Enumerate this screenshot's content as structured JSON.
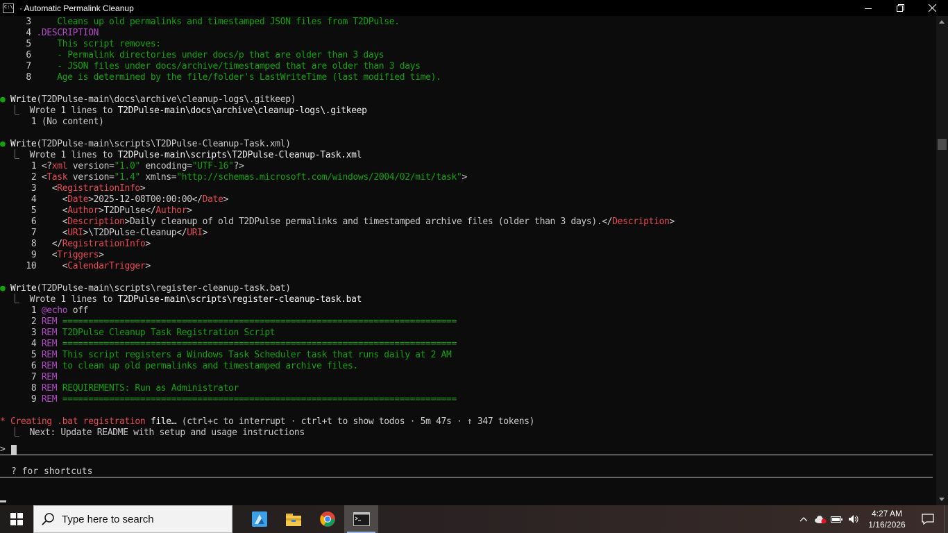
{
  "window": {
    "title": "· Automatic Permalink Cleanup"
  },
  "terminal": {
    "lines": [
      {
        "y": 0,
        "segs": [
          [
            "c-ln",
            "     3 "
          ],
          [
            "c-green",
            "    Cleans up old permalinks and timestamped JSON files from T2DPulse."
          ]
        ]
      },
      {
        "y": 1,
        "segs": [
          [
            "c-ln",
            "     4 "
          ],
          [
            "c-purple",
            ".DESCRIPTION"
          ]
        ]
      },
      {
        "y": 2,
        "segs": [
          [
            "c-ln",
            "     5 "
          ],
          [
            "c-green",
            "    This script removes:"
          ]
        ]
      },
      {
        "y": 3,
        "segs": [
          [
            "c-ln",
            "     6 "
          ],
          [
            "c-green",
            "    - Permalink directories under docs/p that are older than 3 days"
          ]
        ]
      },
      {
        "y": 4,
        "segs": [
          [
            "c-ln",
            "     7 "
          ],
          [
            "c-green",
            "    - JSON files under docs/archive/timestamped that are older than 3 days"
          ]
        ]
      },
      {
        "y": 5,
        "segs": [
          [
            "c-ln",
            "     8 "
          ],
          [
            "c-green",
            "    Age is determined by the file/folder's LastWriteTime (last modified time)."
          ]
        ]
      },
      {
        "y": 7,
        "segs": [
          [
            "bullet-green",
            "● "
          ],
          [
            "c-white",
            "Write"
          ],
          [
            "c-gray",
            "(T2DPulse-main\\docs\\archive\\cleanup-logs\\.gitkeep)"
          ]
        ]
      },
      {
        "y": 8,
        "segs": [
          [
            "glyph-box",
            "  ⎿  "
          ],
          [
            "c-gray",
            "Wrote 1 lines to "
          ],
          [
            "c-white",
            "T2DPulse-main\\docs\\archive\\cleanup-logs\\.gitkeep"
          ]
        ]
      },
      {
        "y": 9,
        "segs": [
          [
            "c-ln",
            "      1 "
          ],
          [
            "c-gray",
            "(No content)"
          ]
        ]
      },
      {
        "y": 11,
        "segs": [
          [
            "bullet-green",
            "● "
          ],
          [
            "c-white",
            "Write"
          ],
          [
            "c-gray",
            "(T2DPulse-main\\scripts\\T2DPulse-Cleanup-Task.xml)"
          ]
        ]
      },
      {
        "y": 12,
        "segs": [
          [
            "glyph-box",
            "  ⎿  "
          ],
          [
            "c-gray",
            "Wrote 1 lines to "
          ],
          [
            "c-white",
            "T2DPulse-main\\scripts\\T2DPulse-Cleanup-Task.xml"
          ]
        ]
      },
      {
        "y": 13,
        "segs": [
          [
            "c-ln",
            "      1 "
          ],
          [
            "c-gray",
            "<?"
          ],
          [
            "c-red",
            "xml"
          ],
          [
            "c-gray",
            " version="
          ],
          [
            "c-green",
            "\"1.0\""
          ],
          [
            "c-gray",
            " encoding="
          ],
          [
            "c-green",
            "\"UTF-16\""
          ],
          [
            "c-gray",
            "?>"
          ]
        ]
      },
      {
        "y": 14,
        "segs": [
          [
            "c-ln",
            "      2 "
          ],
          [
            "c-gray",
            "<"
          ],
          [
            "c-red",
            "Task"
          ],
          [
            "c-gray",
            " version="
          ],
          [
            "c-green",
            "\"1.4\""
          ],
          [
            "c-gray",
            " xmlns="
          ],
          [
            "c-green",
            "\"http://schemas.microsoft.com/windows/2004/02/mit/task\""
          ],
          [
            "c-gray",
            ">"
          ]
        ]
      },
      {
        "y": 15,
        "segs": [
          [
            "c-ln",
            "      3 "
          ],
          [
            "c-gray",
            "  <"
          ],
          [
            "c-red",
            "RegistrationInfo"
          ],
          [
            "c-gray",
            ">"
          ]
        ]
      },
      {
        "y": 16,
        "segs": [
          [
            "c-ln",
            "      4 "
          ],
          [
            "c-gray",
            "    <"
          ],
          [
            "c-red",
            "Date"
          ],
          [
            "c-gray",
            ">2025-12-08T00:00:00</"
          ],
          [
            "c-red",
            "Date"
          ],
          [
            "c-gray",
            ">"
          ]
        ]
      },
      {
        "y": 17,
        "segs": [
          [
            "c-ln",
            "      5 "
          ],
          [
            "c-gray",
            "    <"
          ],
          [
            "c-red",
            "Author"
          ],
          [
            "c-gray",
            ">T2DPulse</"
          ],
          [
            "c-red",
            "Author"
          ],
          [
            "c-gray",
            ">"
          ]
        ]
      },
      {
        "y": 18,
        "segs": [
          [
            "c-ln",
            "      6 "
          ],
          [
            "c-gray",
            "    <"
          ],
          [
            "c-red",
            "Description"
          ],
          [
            "c-gray",
            ">Daily cleanup of old T2DPulse permalinks and timestamped archive files (older than 3 days).</"
          ],
          [
            "c-red",
            "Description"
          ],
          [
            "c-gray",
            ">"
          ]
        ]
      },
      {
        "y": 19,
        "segs": [
          [
            "c-ln",
            "      7 "
          ],
          [
            "c-gray",
            "    <"
          ],
          [
            "c-red",
            "URI"
          ],
          [
            "c-gray",
            ">\\T2DPulse-Cleanup</"
          ],
          [
            "c-red",
            "URI"
          ],
          [
            "c-gray",
            ">"
          ]
        ]
      },
      {
        "y": 20,
        "segs": [
          [
            "c-ln",
            "      8 "
          ],
          [
            "c-gray",
            "  </"
          ],
          [
            "c-red",
            "RegistrationInfo"
          ],
          [
            "c-gray",
            ">"
          ]
        ]
      },
      {
        "y": 21,
        "segs": [
          [
            "c-ln",
            "      9 "
          ],
          [
            "c-gray",
            "  <"
          ],
          [
            "c-red",
            "Triggers"
          ],
          [
            "c-gray",
            ">"
          ]
        ]
      },
      {
        "y": 22,
        "segs": [
          [
            "c-ln",
            "     10 "
          ],
          [
            "c-gray",
            "    <"
          ],
          [
            "c-red",
            "CalendarTrigger"
          ],
          [
            "c-gray",
            ">"
          ]
        ]
      },
      {
        "y": 24,
        "segs": [
          [
            "bullet-green",
            "● "
          ],
          [
            "c-white",
            "Write"
          ],
          [
            "c-gray",
            "(T2DPulse-main\\scripts\\register-cleanup-task.bat)"
          ]
        ]
      },
      {
        "y": 25,
        "segs": [
          [
            "glyph-box",
            "  ⎿  "
          ],
          [
            "c-gray",
            "Wrote 1 lines to "
          ],
          [
            "c-white",
            "T2DPulse-main\\scripts\\register-cleanup-task.bat"
          ]
        ]
      },
      {
        "y": 26,
        "segs": [
          [
            "c-ln",
            "      1 "
          ],
          [
            "c-purple",
            "@echo"
          ],
          [
            "c-gray",
            " off"
          ]
        ]
      },
      {
        "y": 27,
        "segs": [
          [
            "c-ln",
            "      2 "
          ],
          [
            "c-purple",
            "REM"
          ],
          [
            "c-green",
            " ============================================================================"
          ]
        ]
      },
      {
        "y": 28,
        "segs": [
          [
            "c-ln",
            "      3 "
          ],
          [
            "c-purple",
            "REM"
          ],
          [
            "c-green",
            " T2DPulse Cleanup Task Registration Script"
          ]
        ]
      },
      {
        "y": 29,
        "segs": [
          [
            "c-ln",
            "      4 "
          ],
          [
            "c-purple",
            "REM"
          ],
          [
            "c-green",
            " ============================================================================"
          ]
        ]
      },
      {
        "y": 30,
        "segs": [
          [
            "c-ln",
            "      5 "
          ],
          [
            "c-purple",
            "REM"
          ],
          [
            "c-green",
            " This script registers a Windows Task Scheduler task that runs daily at 2 AM"
          ]
        ]
      },
      {
        "y": 31,
        "segs": [
          [
            "c-ln",
            "      6 "
          ],
          [
            "c-purple",
            "REM"
          ],
          [
            "c-green",
            " to clean up old permalinks and timestamped archive files."
          ]
        ]
      },
      {
        "y": 32,
        "segs": [
          [
            "c-ln",
            "      7 "
          ],
          [
            "c-purple",
            "REM"
          ]
        ]
      },
      {
        "y": 33,
        "segs": [
          [
            "c-ln",
            "      8 "
          ],
          [
            "c-purple",
            "REM"
          ],
          [
            "c-green",
            " REQUIREMENTS: Run as Administrator"
          ]
        ]
      },
      {
        "y": 34,
        "segs": [
          [
            "c-ln",
            "      9 "
          ],
          [
            "c-purple",
            "REM"
          ],
          [
            "c-green",
            " ============================================================================"
          ]
        ]
      },
      {
        "y": 36,
        "segs": [
          [
            "bullet-red",
            "* "
          ],
          [
            "c-red",
            "Creating .bat registration "
          ],
          [
            "c-white",
            "file…"
          ],
          [
            "c-gray",
            " (ctrl+c to interrupt · ctrl+t to show todos · 5m 47s · ↑ 347 tokens)"
          ]
        ]
      },
      {
        "y": 37,
        "segs": [
          [
            "glyph-box",
            "  ⎿  "
          ],
          [
            "c-gray",
            "Next: Update README with setup and usage instructions"
          ]
        ]
      }
    ],
    "prompt_symbol": ">",
    "hint_text": "? for shortcuts"
  },
  "taskbar": {
    "search_placeholder": "Type here to search",
    "apps": [
      {
        "name": "paint-3d-icon"
      },
      {
        "name": "file-explorer-icon"
      },
      {
        "name": "chrome-icon"
      },
      {
        "name": "command-prompt-icon",
        "active": true
      }
    ],
    "time": "4:27 AM",
    "date": "1/16/2026"
  },
  "colors": {
    "terminal_bg": "#0c0c0c",
    "green": "#13a10e",
    "red": "#e74856",
    "purple": "#b148c6",
    "text": "#cccccc"
  }
}
